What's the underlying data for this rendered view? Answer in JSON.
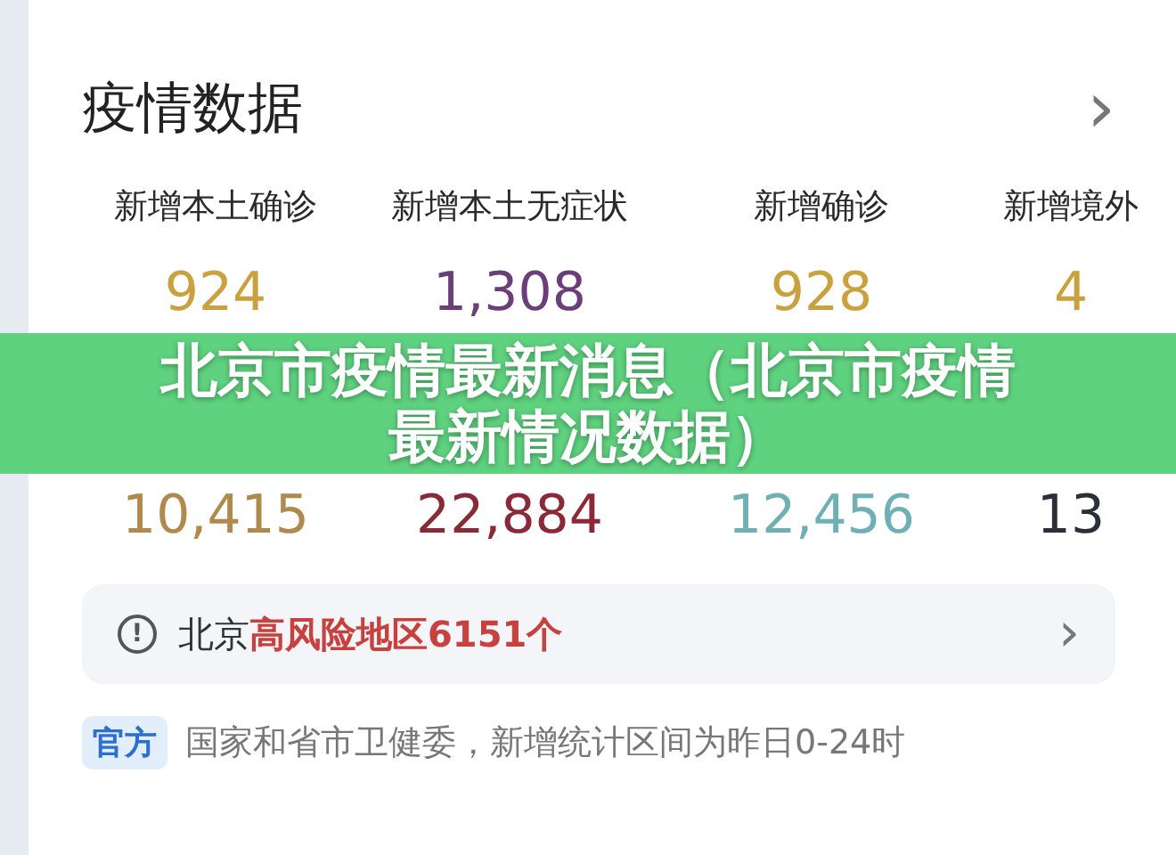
{
  "card": {
    "title": "疫情数据",
    "chevron": "›"
  },
  "stats": [
    {
      "label": "新增本土确诊",
      "value": "924",
      "color": "#c9a23f"
    },
    {
      "label": "新增本土无症状",
      "value": "1,308",
      "color": "#6a3e78"
    },
    {
      "label": "新增确诊",
      "value": "928",
      "color": "#c9a23f"
    },
    {
      "label": "新增境外",
      "value": "4",
      "color": "#c9a23f"
    },
    {
      "value": "10,415",
      "color": "#b08a4c"
    },
    {
      "value": "22,884",
      "color": "#8a2a38"
    },
    {
      "value": "12,456",
      "color": "#6fb0b6"
    },
    {
      "value": "13",
      "color": "#2b2f3a"
    }
  ],
  "alert": {
    "icon": "!",
    "text": "北京**高风险地区6151个**",
    "chevron": "›"
  },
  "source": {
    "tag": "官方",
    "text": "国家和省市卫健委，新增统计区间为昨日0-24时"
  },
  "banner": {
    "headline": "北京市疫情最新消息（北京市疫情最新情况数据）"
  }
}
